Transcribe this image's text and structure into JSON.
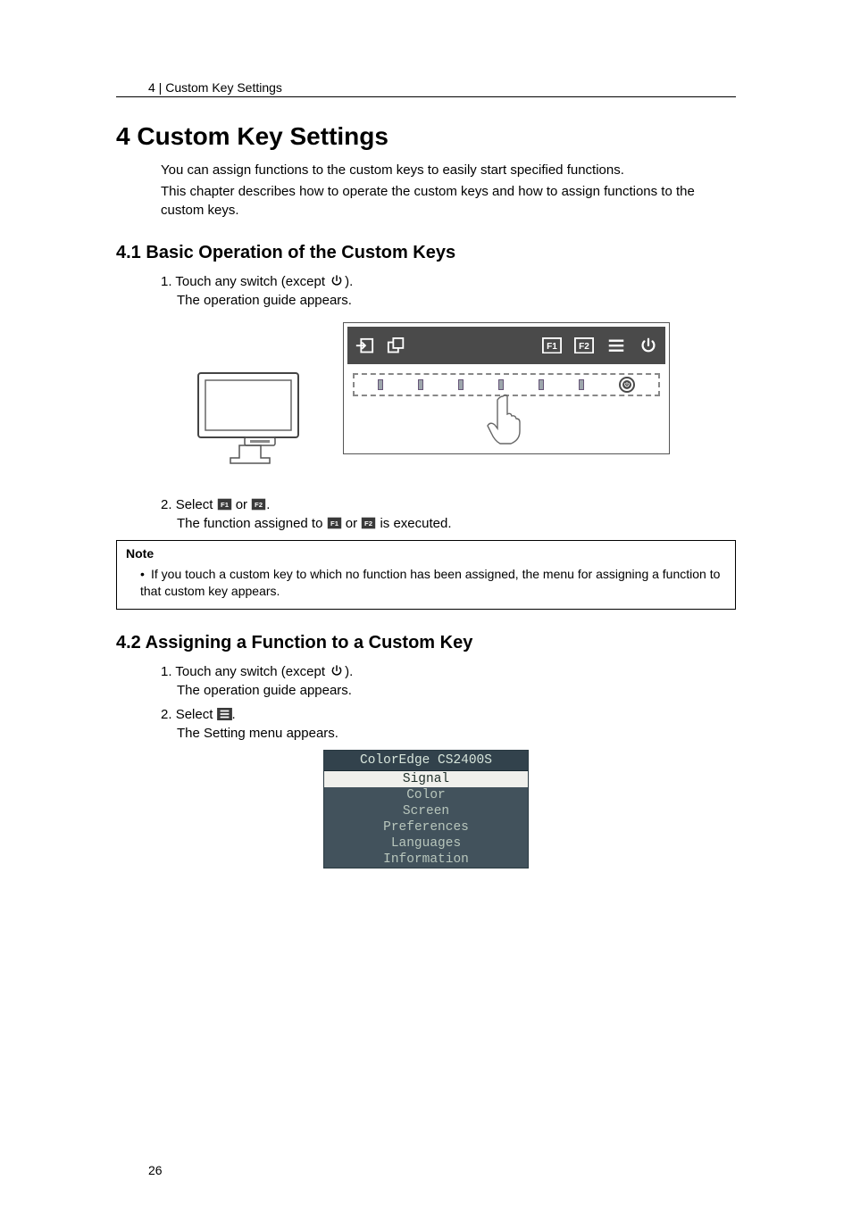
{
  "header": {
    "breadcrumb": "4 | Custom Key Settings"
  },
  "h1": {
    "num": "4",
    "title": "Custom Key Settings"
  },
  "intro": {
    "p1": "You can assign functions to the custom keys to easily start specified functions.",
    "p2": "This chapter describes how to operate the custom keys and how to assign functions to the custom keys."
  },
  "s41": {
    "num": "4.1",
    "title": "Basic Operation of the Custom Keys",
    "step1a": "Touch any switch (except ",
    "step1b": ").",
    "step1sub": "The operation guide appears.",
    "step2a": "Select ",
    "step2or": " or ",
    "step2b": ".",
    "step2suba": "The function assigned to ",
    "step2subb": " or ",
    "step2subc": " is executed."
  },
  "note": {
    "label": "Note",
    "text": "If you touch a custom key to which no function has been assigned, the menu for assigning a function to that custom key appears."
  },
  "s42": {
    "num": "4.2",
    "title": "Assigning a Function to a Custom Key",
    "step1a": "Touch any switch (except ",
    "step1b": ").",
    "step1sub": "The operation guide appears.",
    "step2a": "Select ",
    "step2b": ".",
    "step2sub": "The Setting menu appears."
  },
  "menu": {
    "title": "ColorEdge CS2400S",
    "items": [
      "Signal",
      "Color",
      "Screen",
      "Preferences",
      "Languages",
      "Information"
    ],
    "selected": 0
  },
  "pagenum": "26"
}
